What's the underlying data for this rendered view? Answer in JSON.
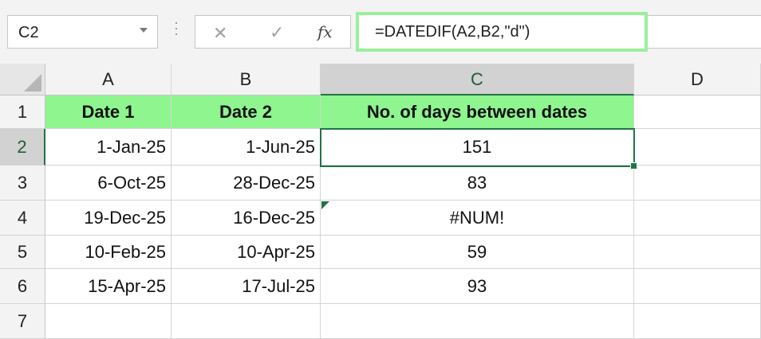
{
  "name_box": {
    "value": "C2"
  },
  "formula_bar": {
    "cancel_icon": "cancel-icon",
    "enter_icon": "enter-icon",
    "function_label": "fx",
    "formula": "=DATEDIF(A2,B2,\"d\")"
  },
  "columns": [
    "A",
    "B",
    "C",
    "D"
  ],
  "rows": [
    "1",
    "2",
    "3",
    "4",
    "5",
    "6",
    "7"
  ],
  "cells": {
    "header": {
      "a": "Date 1",
      "b": "Date 2",
      "c": "No. of days between dates"
    },
    "data": [
      {
        "a": "1-Jan-25",
        "b": "1-Jun-25",
        "c": "151"
      },
      {
        "a": "6-Oct-25",
        "b": "28-Dec-25",
        "c": "83"
      },
      {
        "a": "19-Dec-25",
        "b": "16-Dec-25",
        "c": "#NUM!"
      },
      {
        "a": "10-Feb-25",
        "b": "10-Apr-25",
        "c": "59"
      },
      {
        "a": "15-Apr-25",
        "b": "17-Jul-25",
        "c": "93"
      }
    ]
  },
  "colors": {
    "header_fill": "#8ef58f",
    "selection": "#217346",
    "formula_highlight": "#99f09a"
  }
}
